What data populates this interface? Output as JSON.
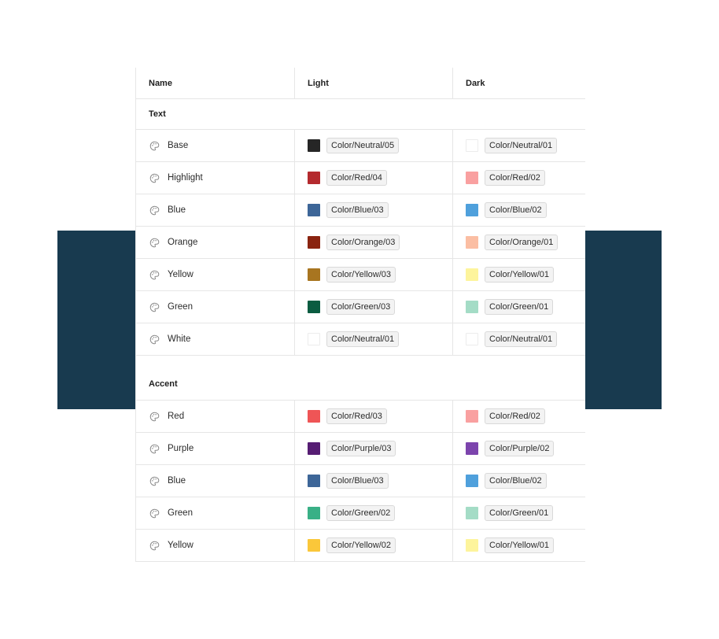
{
  "headers": {
    "name": "Name",
    "light": "Light",
    "dark": "Dark"
  },
  "groups": [
    {
      "label": "Text",
      "rows": [
        {
          "name": "Base",
          "light": {
            "token": "Color/Neutral/05",
            "color": "#262626"
          },
          "dark": {
            "token": "Color/Neutral/01",
            "color": "#ffffff"
          }
        },
        {
          "name": "Highlight",
          "light": {
            "token": "Color/Red/04",
            "color": "#b42a2e"
          },
          "dark": {
            "token": "Color/Red/02",
            "color": "#f9a0a0"
          }
        },
        {
          "name": "Blue",
          "light": {
            "token": "Color/Blue/03",
            "color": "#3d6698"
          },
          "dark": {
            "token": "Color/Blue/02",
            "color": "#4fa0dc"
          }
        },
        {
          "name": "Orange",
          "light": {
            "token": "Color/Orange/03",
            "color": "#8a2410"
          },
          "dark": {
            "token": "Color/Orange/01",
            "color": "#fbbea3"
          }
        },
        {
          "name": "Yellow",
          "light": {
            "token": "Color/Yellow/03",
            "color": "#a87520"
          },
          "dark": {
            "token": "Color/Yellow/01",
            "color": "#fdf49c"
          }
        },
        {
          "name": "Green",
          "light": {
            "token": "Color/Green/03",
            "color": "#0b5c41"
          },
          "dark": {
            "token": "Color/Green/01",
            "color": "#a4dcc6"
          }
        },
        {
          "name": "White",
          "light": {
            "token": "Color/Neutral/01",
            "color": "#ffffff"
          },
          "dark": {
            "token": "Color/Neutral/01",
            "color": "#ffffff"
          }
        }
      ]
    },
    {
      "label": "Accent",
      "rows": [
        {
          "name": "Red",
          "light": {
            "token": "Color/Red/03",
            "color": "#ef5556"
          },
          "dark": {
            "token": "Color/Red/02",
            "color": "#f9a0a0"
          }
        },
        {
          "name": "Purple",
          "light": {
            "token": "Color/Purple/03",
            "color": "#561d73"
          },
          "dark": {
            "token": "Color/Purple/02",
            "color": "#7c44ad"
          }
        },
        {
          "name": "Blue",
          "light": {
            "token": "Color/Blue/03",
            "color": "#3d6698"
          },
          "dark": {
            "token": "Color/Blue/02",
            "color": "#4fa0dc"
          }
        },
        {
          "name": "Green",
          "light": {
            "token": "Color/Green/02",
            "color": "#39b086"
          },
          "dark": {
            "token": "Color/Green/01",
            "color": "#a4dcc6"
          }
        },
        {
          "name": "Yellow",
          "light": {
            "token": "Color/Yellow/02",
            "color": "#fac73a"
          },
          "dark": {
            "token": "Color/Yellow/01",
            "color": "#fdf49c"
          }
        }
      ]
    }
  ],
  "icon": "palette-icon",
  "colors": {
    "backdrop": "#183a4f",
    "border": "#e6e6e6",
    "token_bg": "#f3f3f3"
  }
}
